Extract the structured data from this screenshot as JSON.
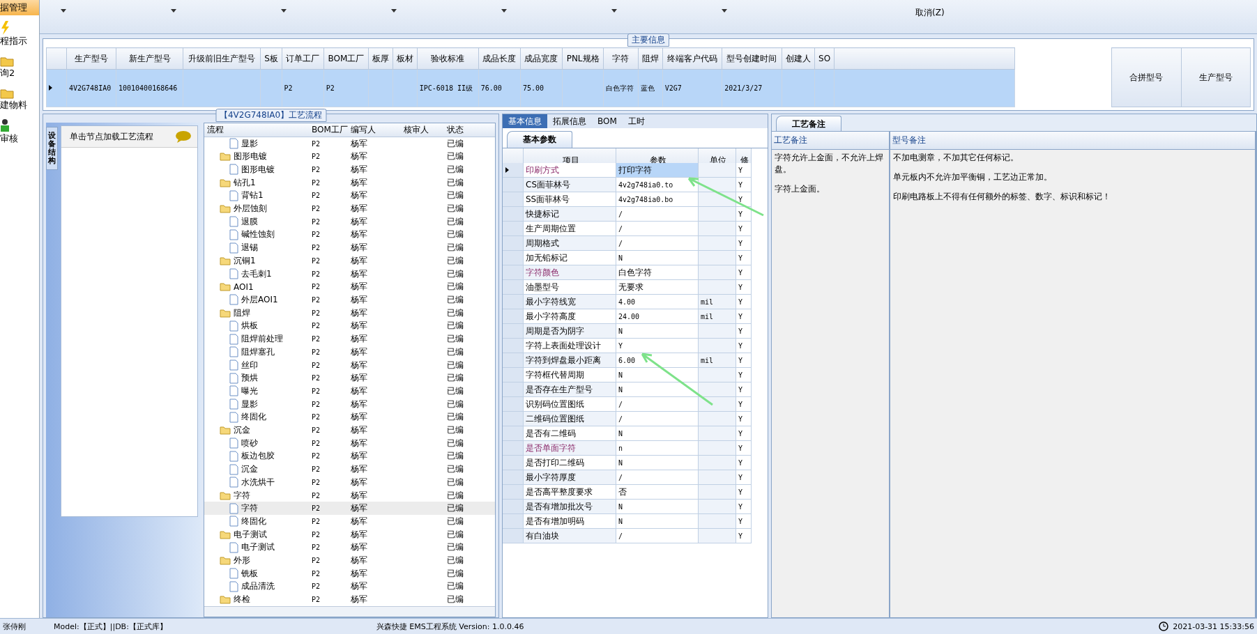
{
  "nav": {
    "items": [
      {
        "label": "据管理",
        "selected": true
      },
      {
        "label": "程指示",
        "selected": false
      },
      {
        "label": "询2",
        "selected": false
      },
      {
        "label": "建物料",
        "selected": false
      },
      {
        "label": "审核",
        "selected": false
      }
    ]
  },
  "ribbon": {
    "buttons": [
      "取消(Z)"
    ]
  },
  "main_info": {
    "title": "主要信息",
    "columns": [
      "生产型号",
      "新生产型号",
      "升级前旧生产型号",
      "S板",
      "订单工厂",
      "BOM工厂",
      "板厚",
      "板材",
      "验收标准",
      "成品长度",
      "成品宽度",
      "PNL规格",
      "字符",
      "阻焊",
      "终端客户代码",
      "型号创建时间",
      "创建人",
      "SO"
    ],
    "rows": [
      {
        "selected": true,
        "cells": [
          "4V2G748IA0",
          "10010400168646",
          "",
          "",
          "P2",
          "P2",
          "",
          "",
          "IPC-6018 II级",
          "76.00",
          "75.00",
          "",
          "白色字符",
          "蓝色",
          "V2G7",
          "2021/3/27",
          "",
          ""
        ]
      }
    ],
    "merge_columns": [
      "合拼型号",
      "生产型号"
    ]
  },
  "process": {
    "title": "【4V2G748IA0】工艺流程",
    "side_tab": "设备结构",
    "side_header": "单击节点加载工艺流程",
    "columns": [
      "流程",
      "BOM工厂",
      "编写人",
      "核审人",
      "状态"
    ],
    "tree": [
      {
        "kind": "file",
        "label": "显影",
        "bom": "P2",
        "writer": "杨军",
        "status": "已编",
        "selected": false
      },
      {
        "kind": "folder",
        "label": "图形电镀",
        "bom": "P2",
        "writer": "杨军",
        "status": "已编",
        "selected": false,
        "children": [
          {
            "kind": "file",
            "label": "图形电镀",
            "bom": "P2",
            "writer": "杨军",
            "status": "已编",
            "selected": false
          }
        ]
      },
      {
        "kind": "folder",
        "label": "钻孔1",
        "bom": "P2",
        "writer": "杨军",
        "status": "已编",
        "selected": false,
        "children": [
          {
            "kind": "file",
            "label": "背钻1",
            "bom": "P2",
            "writer": "杨军",
            "status": "已编",
            "selected": false
          }
        ]
      },
      {
        "kind": "folder",
        "label": "外层蚀刻",
        "bom": "P2",
        "writer": "杨军",
        "status": "已编",
        "selected": false,
        "children": [
          {
            "kind": "file",
            "label": "退膜",
            "bom": "P2",
            "writer": "杨军",
            "status": "已编",
            "selected": false
          },
          {
            "kind": "file",
            "label": "碱性蚀刻",
            "bom": "P2",
            "writer": "杨军",
            "status": "已编",
            "selected": false
          },
          {
            "kind": "file",
            "label": "退锡",
            "bom": "P2",
            "writer": "杨军",
            "status": "已编",
            "selected": false
          }
        ]
      },
      {
        "kind": "folder",
        "label": "沉铜1",
        "bom": "P2",
        "writer": "杨军",
        "status": "已编",
        "selected": false,
        "children": [
          {
            "kind": "file",
            "label": "去毛刺1",
            "bom": "P2",
            "writer": "杨军",
            "status": "已编",
            "selected": false
          }
        ]
      },
      {
        "kind": "folder",
        "label": "AOI1",
        "bom": "P2",
        "writer": "杨军",
        "status": "已编",
        "selected": false,
        "children": [
          {
            "kind": "file",
            "label": "外层AOI1",
            "bom": "P2",
            "writer": "杨军",
            "status": "已编",
            "selected": false
          }
        ]
      },
      {
        "kind": "folder",
        "label": "阻焊",
        "bom": "P2",
        "writer": "杨军",
        "status": "已编",
        "selected": false,
        "children": [
          {
            "kind": "file",
            "label": "烘板",
            "bom": "P2",
            "writer": "杨军",
            "status": "已编",
            "selected": false
          },
          {
            "kind": "file",
            "label": "阻焊前处理",
            "bom": "P2",
            "writer": "杨军",
            "status": "已编",
            "selected": false
          },
          {
            "kind": "file",
            "label": "阻焊塞孔",
            "bom": "P2",
            "writer": "杨军",
            "status": "已编",
            "selected": false
          },
          {
            "kind": "file",
            "label": "丝印",
            "bom": "P2",
            "writer": "杨军",
            "status": "已编",
            "selected": false
          },
          {
            "kind": "file",
            "label": "预烘",
            "bom": "P2",
            "writer": "杨军",
            "status": "已编",
            "selected": false
          },
          {
            "kind": "file",
            "label": "曝光",
            "bom": "P2",
            "writer": "杨军",
            "status": "已编",
            "selected": false
          },
          {
            "kind": "file",
            "label": "显影",
            "bom": "P2",
            "writer": "杨军",
            "status": "已编",
            "selected": false
          },
          {
            "kind": "file",
            "label": "终固化",
            "bom": "P2",
            "writer": "杨军",
            "status": "已编",
            "selected": false
          }
        ]
      },
      {
        "kind": "folder",
        "label": "沉金",
        "bom": "P2",
        "writer": "杨军",
        "status": "已编",
        "selected": false,
        "children": [
          {
            "kind": "file",
            "label": "喷砂",
            "bom": "P2",
            "writer": "杨军",
            "status": "已编",
            "selected": false
          },
          {
            "kind": "file",
            "label": "板边包胶",
            "bom": "P2",
            "writer": "杨军",
            "status": "已编",
            "selected": false
          },
          {
            "kind": "file",
            "label": "沉金",
            "bom": "P2",
            "writer": "杨军",
            "status": "已编",
            "selected": false
          },
          {
            "kind": "file",
            "label": "水洗烘干",
            "bom": "P2",
            "writer": "杨军",
            "status": "已编",
            "selected": false
          }
        ]
      },
      {
        "kind": "folder",
        "label": "字符",
        "bom": "P2",
        "writer": "杨军",
        "status": "已编",
        "selected": false,
        "children": [
          {
            "kind": "file",
            "label": "字符",
            "bom": "P2",
            "writer": "杨军",
            "status": "已编",
            "selected": true
          },
          {
            "kind": "file",
            "label": "终固化",
            "bom": "P2",
            "writer": "杨军",
            "status": "已编",
            "selected": false
          }
        ]
      },
      {
        "kind": "folder",
        "label": "电子测试",
        "bom": "P2",
        "writer": "杨军",
        "status": "已编",
        "selected": false,
        "children": [
          {
            "kind": "file",
            "label": "电子测试",
            "bom": "P2",
            "writer": "杨军",
            "status": "已编",
            "selected": false
          }
        ]
      },
      {
        "kind": "folder",
        "label": "外形",
        "bom": "P2",
        "writer": "杨军",
        "status": "已编",
        "selected": false,
        "children": [
          {
            "kind": "file",
            "label": "铣板",
            "bom": "P2",
            "writer": "杨军",
            "status": "已编",
            "selected": false
          },
          {
            "kind": "file",
            "label": "成品清洗",
            "bom": "P2",
            "writer": "杨军",
            "status": "已编",
            "selected": false
          }
        ]
      },
      {
        "kind": "folder",
        "label": "终检",
        "bom": "P2",
        "writer": "杨军",
        "status": "已编",
        "selected": false
      }
    ]
  },
  "detail_tabs": [
    {
      "label": "基本信息",
      "selected": true
    },
    {
      "label": "拓展信息",
      "selected": false
    },
    {
      "label": "BOM",
      "selected": false
    },
    {
      "label": "工时",
      "selected": false
    }
  ],
  "params": {
    "tab": "基本参数",
    "columns": [
      "项目",
      "参数",
      "单位",
      "修"
    ],
    "rows": [
      {
        "item": "印刷方式",
        "value": "打印字符",
        "unit": "",
        "flag": "Y",
        "flagged": true,
        "selected": true
      },
      {
        "item": "CS面菲林号",
        "value": "4v2g748ia0.to",
        "unit": "",
        "flag": "Y",
        "flagged": false,
        "selected": false
      },
      {
        "item": "SS面菲林号",
        "value": "4v2g748ia0.bo",
        "unit": "",
        "flag": "Y",
        "flagged": false,
        "selected": false
      },
      {
        "item": "快捷标记",
        "value": "/",
        "unit": "",
        "flag": "Y",
        "flagged": false,
        "selected": false
      },
      {
        "item": "生产周期位置",
        "value": "/",
        "unit": "",
        "flag": "Y",
        "flagged": false,
        "selected": false
      },
      {
        "item": "周期格式",
        "value": "/",
        "unit": "",
        "flag": "Y",
        "flagged": false,
        "selected": false
      },
      {
        "item": "加无铅标记",
        "value": "N",
        "unit": "",
        "flag": "Y",
        "flagged": false,
        "selected": false
      },
      {
        "item": "字符颜色",
        "value": "白色字符",
        "unit": "",
        "flag": "Y",
        "flagged": true,
        "selected": false
      },
      {
        "item": "油墨型号",
        "value": "无要求",
        "unit": "",
        "flag": "Y",
        "flagged": false,
        "selected": false
      },
      {
        "item": "最小字符线宽",
        "value": "4.00",
        "unit": "mil",
        "flag": "Y",
        "flagged": false,
        "selected": false
      },
      {
        "item": "最小字符高度",
        "value": "24.00",
        "unit": "mil",
        "flag": "Y",
        "flagged": false,
        "selected": false
      },
      {
        "item": "周期是否为阴字",
        "value": "N",
        "unit": "",
        "flag": "Y",
        "flagged": false,
        "selected": false
      },
      {
        "item": "字符上表面处理设计",
        "value": "Y",
        "unit": "",
        "flag": "Y",
        "flagged": false,
        "selected": false
      },
      {
        "item": "字符到焊盘最小距离",
        "value": "6.00",
        "unit": "mil",
        "flag": "Y",
        "flagged": false,
        "selected": false
      },
      {
        "item": "字符框代替周期",
        "value": "N",
        "unit": "",
        "flag": "Y",
        "flagged": false,
        "selected": false
      },
      {
        "item": "是否存在生产型号",
        "value": "N",
        "unit": "",
        "flag": "Y",
        "flagged": false,
        "selected": false
      },
      {
        "item": "识别码位置图纸",
        "value": "/",
        "unit": "",
        "flag": "Y",
        "flagged": false,
        "selected": false
      },
      {
        "item": "二维码位置图纸",
        "value": "/",
        "unit": "",
        "flag": "Y",
        "flagged": false,
        "selected": false
      },
      {
        "item": "是否有二维码",
        "value": "N",
        "unit": "",
        "flag": "Y",
        "flagged": false,
        "selected": false
      },
      {
        "item": "是否单面字符",
        "value": "n",
        "unit": "",
        "flag": "Y",
        "flagged": true,
        "selected": false
      },
      {
        "item": "是否打印二维码",
        "value": "N",
        "unit": "",
        "flag": "Y",
        "flagged": false,
        "selected": false
      },
      {
        "item": "最小字符厚度",
        "value": "/",
        "unit": "",
        "flag": "Y",
        "flagged": false,
        "selected": false
      },
      {
        "item": "是否高平整度要求",
        "value": "否",
        "unit": "",
        "flag": "Y",
        "flagged": false,
        "selected": false
      },
      {
        "item": "是否有增加批次号",
        "value": "N",
        "unit": "",
        "flag": "Y",
        "flagged": false,
        "selected": false
      },
      {
        "item": "是否有增加明码",
        "value": "N",
        "unit": "",
        "flag": "Y",
        "flagged": false,
        "selected": false
      },
      {
        "item": "有白油块",
        "value": "/",
        "unit": "",
        "flag": "Y",
        "flagged": false,
        "selected": false
      }
    ]
  },
  "remarks": {
    "tab": "工艺备注",
    "columns": [
      "工艺备注",
      "型号备注"
    ],
    "process_notes": [
      "字符允许上金面，不允许上焊盘。",
      "字符上金面。"
    ],
    "model_notes": [
      "不加电测章，不加其它任何标记。",
      "单元板内不允许加平衡铜，工艺边正常加。",
      "印刷电路板上不得有任何额外的标签、数字、标识和标记！"
    ]
  },
  "status_bar": {
    "user": "张侍刚",
    "mode": "Model:【正式】||DB:【正式库】",
    "app": "兴森快捷 EMS工程系统 Version: 1.0.0.46",
    "time": "2021-03-31 15:33:56"
  }
}
